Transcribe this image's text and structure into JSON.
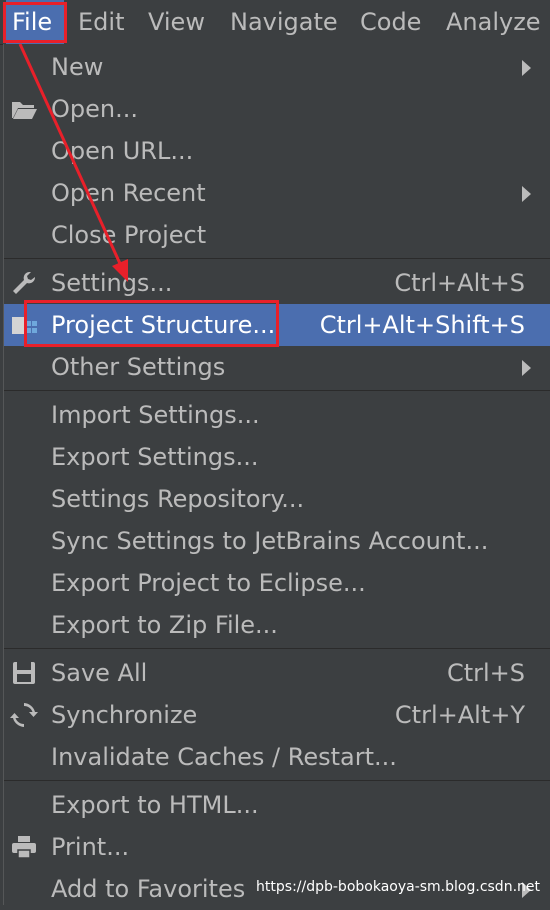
{
  "menubar": {
    "items": [
      "File",
      "Edit",
      "View",
      "Navigate",
      "Code",
      "Analyze"
    ]
  },
  "menu": {
    "new": "New",
    "open": "Open...",
    "open_url": "Open URL...",
    "open_recent": "Open Recent",
    "close_project": "Close Project",
    "settings": "Settings...",
    "settings_shortcut": "Ctrl+Alt+S",
    "project_structure": "Project Structure...",
    "project_structure_shortcut": "Ctrl+Alt+Shift+S",
    "other_settings": "Other Settings",
    "import_settings": "Import Settings...",
    "export_settings": "Export Settings...",
    "settings_repository": "Settings Repository...",
    "sync_settings": "Sync Settings to JetBrains Account...",
    "export_eclipse": "Export Project to Eclipse...",
    "export_zip": "Export to Zip File...",
    "save_all": "Save All",
    "save_all_shortcut": "Ctrl+S",
    "synchronize": "Synchronize",
    "synchronize_shortcut": "Ctrl+Alt+Y",
    "invalidate": "Invalidate Caches / Restart...",
    "export_html": "Export to HTML...",
    "print": "Print...",
    "add_favorites": "Add to Favorites"
  },
  "watermark": "https://dpb-bobokaoya-sm.blog.csdn.net",
  "colors": {
    "background": "#3c3f41",
    "selection": "#4b6eaf",
    "annotation": "#e8202a"
  }
}
